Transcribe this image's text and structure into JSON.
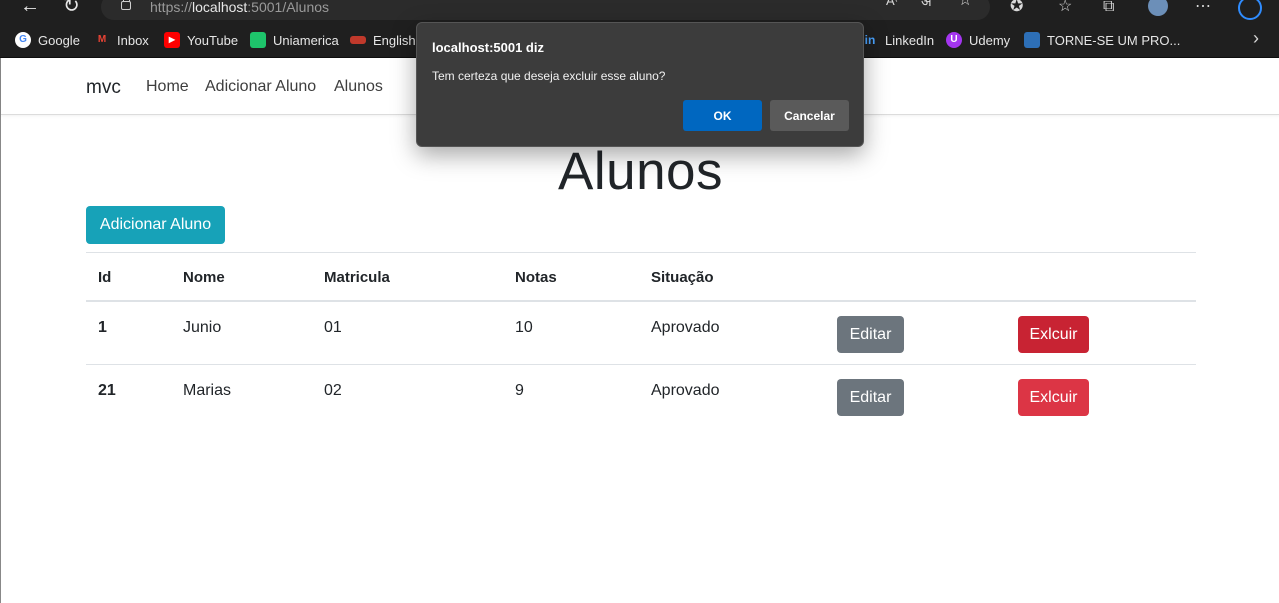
{
  "browser": {
    "url_prefix": "https://",
    "url_host": "localhost",
    "url_rest": ":5001/Alunos"
  },
  "bookmarks": [
    {
      "label": "Google",
      "icon": "google-icon",
      "color": "#4285f4"
    },
    {
      "label": "Inbox",
      "icon": "gmail-icon",
      "color": "#ea4335"
    },
    {
      "label": "YouTube",
      "icon": "youtube-icon",
      "color": "#ff0000"
    },
    {
      "label": "Uniamerica",
      "icon": "uniamerica-icon",
      "color": "#1ec46b"
    },
    {
      "label": "EnglishC",
      "icon": "englishc-icon",
      "color": "#c0392b"
    },
    {
      "label": "LinkedIn",
      "icon": "linkedin-icon",
      "color": "#0a66c2"
    },
    {
      "label": "Udemy",
      "icon": "udemy-icon",
      "color": "#a435f0"
    },
    {
      "label": "TORNE-SE UM PRO...",
      "icon": "torne-se-icon",
      "color": "#2d6fb7"
    }
  ],
  "navbar": {
    "brand": "mvc",
    "links": [
      "Home",
      "Adicionar Aluno",
      "Alunos"
    ]
  },
  "page": {
    "title": "Alunos",
    "add_button": "Adicionar Aluno"
  },
  "table": {
    "headers": [
      "Id",
      "Nome",
      "Matricula",
      "Notas",
      "Situação"
    ],
    "rows": [
      {
        "id": "1",
        "nome": "Junio",
        "matricula": "01",
        "notas": "10",
        "situacao": "Aprovado",
        "edit": "Editar",
        "delete": "Exlcuir"
      },
      {
        "id": "21",
        "nome": "Marias",
        "matricula": "02",
        "notas": "9",
        "situacao": "Aprovado",
        "edit": "Editar",
        "delete": "Exlcuir"
      }
    ]
  },
  "dialog": {
    "title": "localhost:5001 diz",
    "message": "Tem certeza que deseja excluir esse aluno?",
    "ok": "OK",
    "cancel": "Cancelar"
  },
  "colors": {
    "info": "#17a2b8",
    "secondary": "#6c757d",
    "danger": "#dc3545",
    "dialog_bg": "#3c3c3c",
    "dialog_ok": "#0067c0"
  }
}
